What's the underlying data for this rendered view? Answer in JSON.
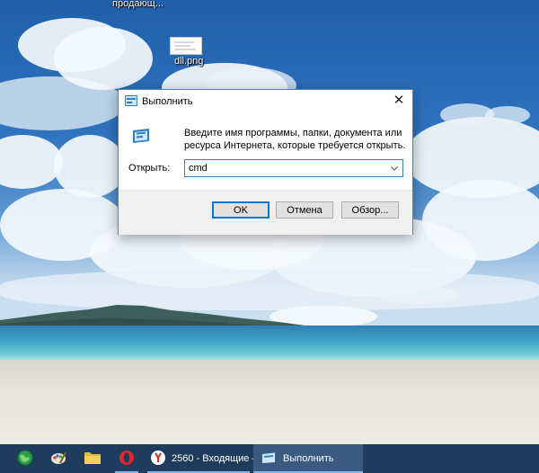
{
  "desktop": {
    "icons": [
      {
        "label": "продающ..."
      },
      {
        "label": "dll.png"
      }
    ]
  },
  "dialog": {
    "title": "Выполнить",
    "description": "Введите имя программы, папки, документа или ресурса Интернета, которые требуется открыть.",
    "open_label": "Открыть:",
    "open_value": "cmd",
    "buttons": {
      "ok": "OK",
      "cancel": "Отмена",
      "browse": "Обзор..."
    }
  },
  "taskbar": {
    "items": [
      {
        "label": "2560 - Входящие —..."
      },
      {
        "label": "Выполнить"
      }
    ]
  },
  "colors": {
    "taskbar": "#1e3c5c",
    "taskbar_active": "#3a5a80",
    "accent": "#0078d7"
  }
}
